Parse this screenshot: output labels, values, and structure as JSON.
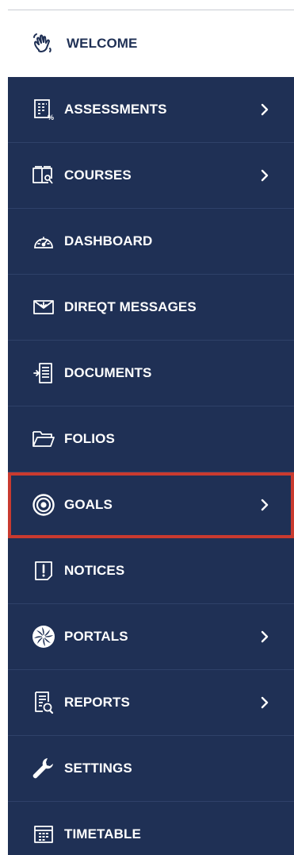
{
  "welcome": {
    "label": "WELCOME",
    "icon": "waving-hand-icon"
  },
  "menu": {
    "background": "#1f3055",
    "highlight_color": "#c93a2f",
    "items": [
      {
        "label": "ASSESSMENTS",
        "icon": "assessment-grid-percent-icon",
        "has_submenu": true
      },
      {
        "label": "COURSES",
        "icon": "open-book-icon",
        "has_submenu": true
      },
      {
        "label": "DASHBOARD",
        "icon": "speedometer-icon",
        "has_submenu": false
      },
      {
        "label": "DIREQT MESSAGES",
        "icon": "envelope-icon",
        "has_submenu": false
      },
      {
        "label": "DOCUMENTS",
        "icon": "document-icon",
        "has_submenu": false
      },
      {
        "label": "FOLIOS",
        "icon": "folder-icon",
        "has_submenu": false
      },
      {
        "label": "GOALS",
        "icon": "target-icon",
        "has_submenu": true,
        "highlighted": true
      },
      {
        "label": "NOTICES",
        "icon": "notice-exclamation-icon",
        "has_submenu": false
      },
      {
        "label": "PORTALS",
        "icon": "portal-swirl-icon",
        "has_submenu": true
      },
      {
        "label": "REPORTS",
        "icon": "report-magnifier-icon",
        "has_submenu": true
      },
      {
        "label": "SETTINGS",
        "icon": "wrench-icon",
        "has_submenu": false
      },
      {
        "label": "TIMETABLE",
        "icon": "timetable-grid-icon",
        "has_submenu": false
      }
    ]
  }
}
